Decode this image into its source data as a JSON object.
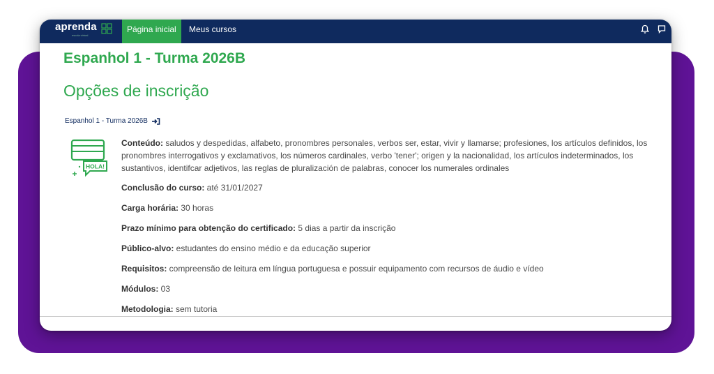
{
  "navbar": {
    "logo_text": "aprenda",
    "logo_sub": "escola virtual",
    "home_label": "Página inicial",
    "courses_label": "Meus cursos",
    "icons": [
      "bell-icon",
      "chat-icon"
    ]
  },
  "course": {
    "title": "Espanhol 1 - Turma 2026B"
  },
  "page": {
    "section_title": "Opções de inscrição",
    "enrol_link": "Espanhol 1 - Turma 2026B",
    "icon_text": "HOLA!"
  },
  "details": {
    "content_label": "Conteúdo:",
    "content_value": " saludos y despedidas, alfabeto, pronombres personales, verbos ser, estar, vivir y llamarse; profesiones, los artículos definidos, los pronombres interrogativos y exclamativos, los números cardinales, verbo 'tener'; origen y la nacionalidad, los artículos indeterminados, los sustantivos, identifcar adjetivos, las reglas de pluralización de palabras, conocer los numerales ordinales",
    "conclusion_label": "Conclusão do curso:",
    "conclusion_value": " até 31/01/2027",
    "workload_label": "Carga horária:",
    "workload_value": " 30 horas",
    "deadline_label": "Prazo mínimo para obtenção do certificado:",
    "deadline_value": " 5 dias a partir da inscrição",
    "audience_label": "Público-alvo:",
    "audience_value": " estudantes do ensino médio e da educação superior",
    "requirements_label": "Requisitos:",
    "requirements_value": " compreensão de leitura em língua portuguesa e possuir equipamento com recursos de áudio e vídeo",
    "modules_label": "Módulos:",
    "modules_value": " 03",
    "methodology_label": "Metodologia:",
    "methodology_value": " sem tutoria"
  },
  "colors": {
    "navbar": "#0f2a5e",
    "accent_green": "#2fa84f",
    "background_purple": "#5f1396"
  }
}
